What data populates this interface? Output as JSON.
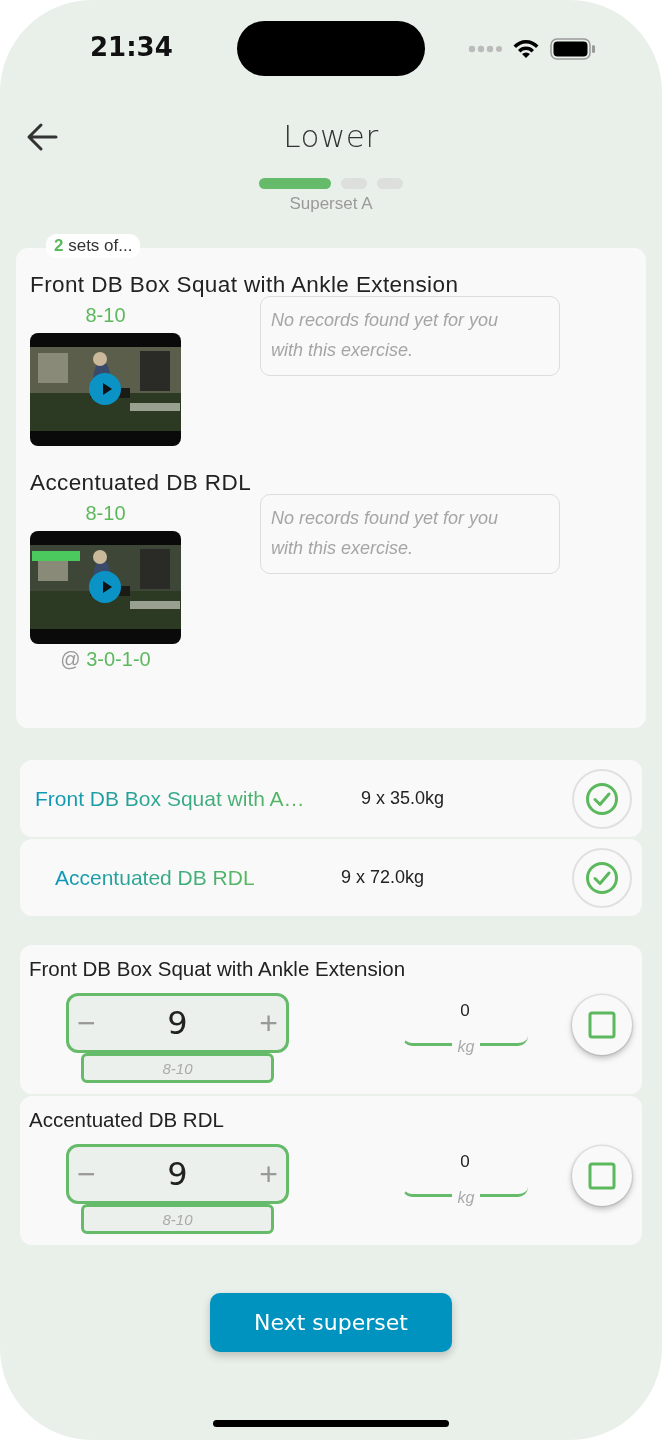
{
  "status_bar": {
    "time": "21:34"
  },
  "header": {
    "title": "Lower"
  },
  "progress": {
    "segments": [
      {
        "selected": true
      },
      {
        "selected": false
      },
      {
        "selected": false
      }
    ],
    "label": "Superset A"
  },
  "superset_card": {
    "badge": "**2** sets of...",
    "exercises": [
      {
        "name": "Front DB Box Squat with Ankle Extension",
        "reps": "8-10",
        "records": "No records found yet for you with this exercise."
      },
      {
        "name": "Accentuated DB RDL",
        "reps": "8-10",
        "records": "No records found yet for you with this exercise.",
        "tempo": {
          "prefix": "@",
          "value": "3-0-1-0"
        }
      }
    ]
  },
  "completed_sets": [
    {
      "name": "Front DB Box Squat with A…",
      "result": "9 x 35.0kg",
      "done": true
    },
    {
      "name": "Accentuated DB RDL",
      "result": "9 x 72.0kg",
      "done": true
    }
  ],
  "current_sets": [
    {
      "name": "Front DB Box Squat with Ankle Extension",
      "minus": "−",
      "reps": "9",
      "plus": "+",
      "range": "8-10",
      "weight": "0",
      "unit": "kg",
      "checked": false
    },
    {
      "name": "Accentuated DB RDL",
      "minus": "−",
      "reps": "9",
      "plus": "+",
      "range": "8-10",
      "weight": "0",
      "unit": "kg",
      "checked": false
    }
  ],
  "next_button": "Next superset"
}
